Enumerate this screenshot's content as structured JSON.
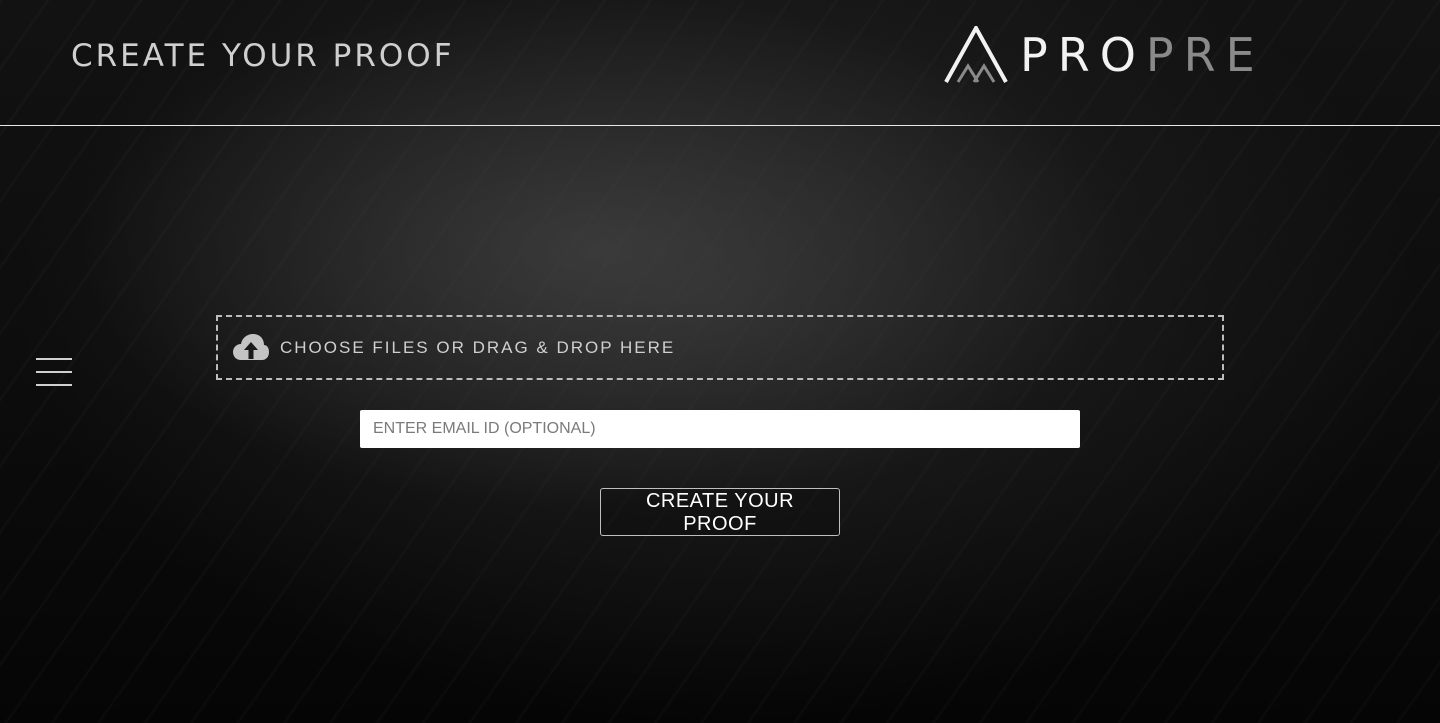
{
  "header": {
    "title": "CREATE YOUR PROOF",
    "logo": {
      "text_primary": "PRO",
      "text_secondary": "PRE",
      "primary_color": "#f2f2f2",
      "secondary_color": "#8a8a8a"
    }
  },
  "nav": {
    "menu_icon": "hamburger-icon"
  },
  "upload": {
    "icon": "cloud-upload-icon",
    "label": "CHOOSE FILES OR DRAG & DROP HERE"
  },
  "email": {
    "value": "",
    "placeholder": "ENTER EMAIL ID (OPTIONAL)"
  },
  "actions": {
    "submit_label": "CREATE YOUR PROOF"
  }
}
